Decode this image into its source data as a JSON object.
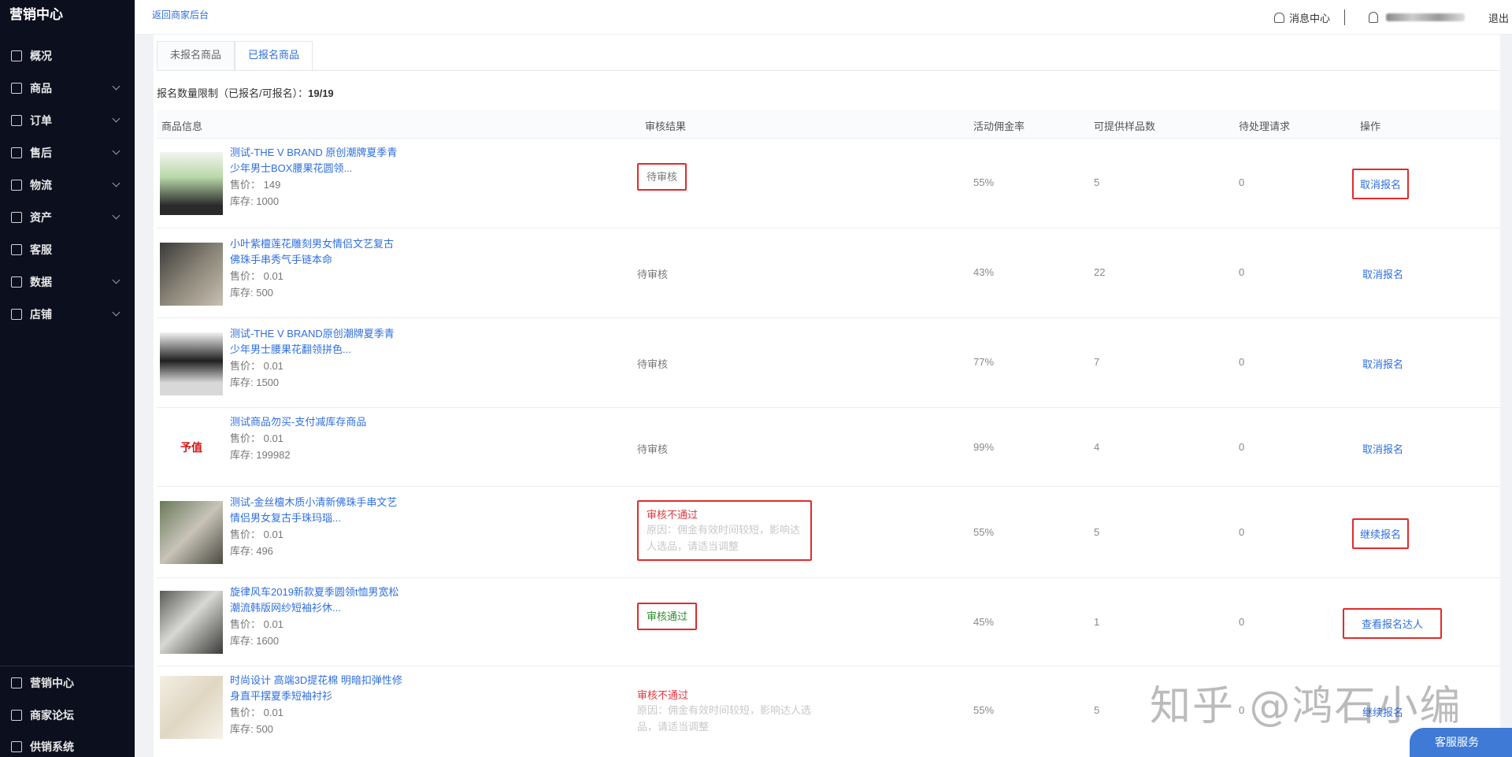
{
  "sidebar": {
    "brand": "营销中心",
    "items": [
      {
        "label": "概况",
        "has_submenu": false
      },
      {
        "label": "商品",
        "has_submenu": true
      },
      {
        "label": "订单",
        "has_submenu": true
      },
      {
        "label": "售后",
        "has_submenu": true
      },
      {
        "label": "物流",
        "has_submenu": true
      },
      {
        "label": "资产",
        "has_submenu": true
      },
      {
        "label": "客服",
        "has_submenu": false
      },
      {
        "label": "数据",
        "has_submenu": true
      },
      {
        "label": "店铺",
        "has_submenu": true
      }
    ],
    "bottom": [
      {
        "label": "营销中心"
      },
      {
        "label": "商家论坛"
      },
      {
        "label": "供销系统"
      }
    ]
  },
  "header": {
    "back_link": "返回商家后台",
    "message_center": "消息中心",
    "logout": "退出"
  },
  "tabs": [
    {
      "label": "未报名商品",
      "active": false
    },
    {
      "label": "已报名商品",
      "active": true
    }
  ],
  "quota": {
    "label": "报名数量限制（已报名/可报名）：",
    "value": "19/19"
  },
  "table": {
    "headers": [
      "商品信息",
      "审核结果",
      "活动佣金率",
      "可提供样品数",
      "待处理请求",
      "操作"
    ],
    "rows": [
      {
        "title": "测试-THE V BRAND 原创潮牌夏季青少年男士BOX腰果花圆领...",
        "price": "售价： 149",
        "stock": "库存: 1000",
        "audit": "待审核",
        "audit_reason": "",
        "commission": "55%",
        "samples": "5",
        "pending": "0",
        "action": "取消报名"
      },
      {
        "title": "小叶紫檀莲花雕刻男女情侣文艺复古佛珠手串秀气手链本命",
        "price": "售价： 0.01",
        "stock": "库存: 500",
        "audit": "待审核",
        "audit_reason": "",
        "commission": "43%",
        "samples": "22",
        "pending": "0",
        "action": "取消报名"
      },
      {
        "title": "测试-THE V BRAND原创潮牌夏季青少年男士腰果花翻领拼色...",
        "price": "售价： 0.01",
        "stock": "库存: 1500",
        "audit": "待审核",
        "audit_reason": "",
        "commission": "77%",
        "samples": "7",
        "pending": "0",
        "action": "取消报名"
      },
      {
        "title": "测试商品勿买-支付减库存商品",
        "price": "售价： 0.01",
        "stock": "库存: 199982",
        "audit": "待审核",
        "audit_reason": "",
        "commission": "99%",
        "samples": "4",
        "pending": "0",
        "action": "取消报名",
        "thumb_text": "予值"
      },
      {
        "title": "测试-金丝檀木质小清新佛珠手串文艺情侣男女复古手珠玛瑙...",
        "price": "售价： 0.01",
        "stock": "库存: 496",
        "audit": "审核不通过",
        "audit_reason": "原因：佣金有效时间较短，影响达人选品，请适当调整",
        "commission": "55%",
        "samples": "5",
        "pending": "0",
        "action": "继续报名"
      },
      {
        "title": "旋律风车2019新款夏季圆领t恤男宽松潮流韩版网纱短袖衫休...",
        "price": "售价： 0.01",
        "stock": "库存: 1600",
        "audit": "审核通过",
        "audit_reason": "",
        "commission": "45%",
        "samples": "1",
        "pending": "0",
        "action": "查看报名达人"
      },
      {
        "title": "时尚设计 高端3D提花棉 明暗扣弹性修身直平摆夏季短袖衬衫",
        "price": "售价： 0.01",
        "stock": "库存: 500",
        "audit": "审核不通过",
        "audit_reason": "原因：佣金有效时间较短，影响达人选品，请适当调整",
        "commission": "55%",
        "samples": "5",
        "pending": "0",
        "action": "继续报名"
      }
    ]
  },
  "watermark": "知乎 @鸿石小编",
  "service_button": "客服服务",
  "colors": {
    "sidebar_bg": "#0b0f1e",
    "link": "#2f6fe0",
    "fail": "#e0383e",
    "pass": "#2f8f2f",
    "highlight_box": "#e02b2b"
  }
}
